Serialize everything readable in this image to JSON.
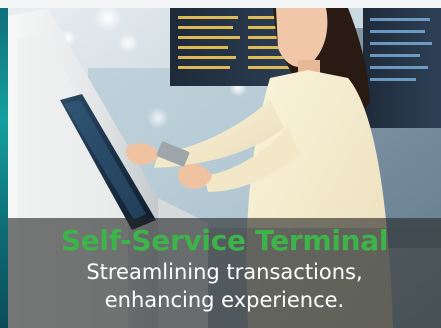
{
  "banner": {
    "headline": "Self-Service Terminal",
    "subtitle_line1": "Streamlining transactions,",
    "subtitle_line2": "enhancing experience."
  },
  "colors": {
    "headline": "#3db34a",
    "subtitle": "#ffffff",
    "overlay": "#262828",
    "accent_strip": "#14a0a0"
  },
  "photo": {
    "icons": [
      "kiosk-icon",
      "touchscreen-icon",
      "smartphone-icon",
      "departure-board-icon"
    ]
  }
}
